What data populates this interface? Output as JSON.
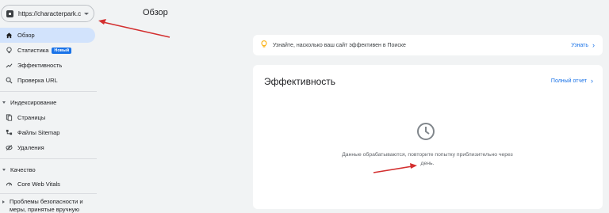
{
  "sidebar": {
    "property_url": "https://characterpark.c...",
    "items": [
      {
        "label": "Обзор",
        "icon": "home-icon"
      },
      {
        "label": "Статистика",
        "icon": "search-insights-icon",
        "badge": "Новый"
      },
      {
        "label": "Эффективность",
        "icon": "trending-icon"
      },
      {
        "label": "Проверка URL",
        "icon": "search-icon"
      }
    ],
    "indexing": {
      "label": "Индексирование",
      "items": [
        {
          "label": "Страницы",
          "icon": "pages-icon"
        },
        {
          "label": "Файлы Sitemap",
          "icon": "sitemap-icon"
        },
        {
          "label": "Удаления",
          "icon": "removals-icon"
        }
      ]
    },
    "quality": {
      "label": "Качество",
      "items": [
        {
          "label": "Core Web Vitals",
          "icon": "gauge-icon"
        }
      ]
    },
    "security": {
      "label_line1": "Проблемы безопасности и",
      "label_line2": "меры, принятые вручную"
    }
  },
  "header": {
    "title": "Обзор"
  },
  "tip": {
    "text": "Узнайте, насколько ваш сайт эффективен в Поиске",
    "link": "Узнать"
  },
  "performance": {
    "title": "Эффективность",
    "link": "Полный отчет",
    "message_line1": "Данные обрабатываются, повторите попытку приблизительно через",
    "message_line2": "день."
  },
  "colors": {
    "accent": "#1a73e8",
    "active_bg": "#d2e3fc",
    "annotation_arrow": "#d32f2f"
  }
}
